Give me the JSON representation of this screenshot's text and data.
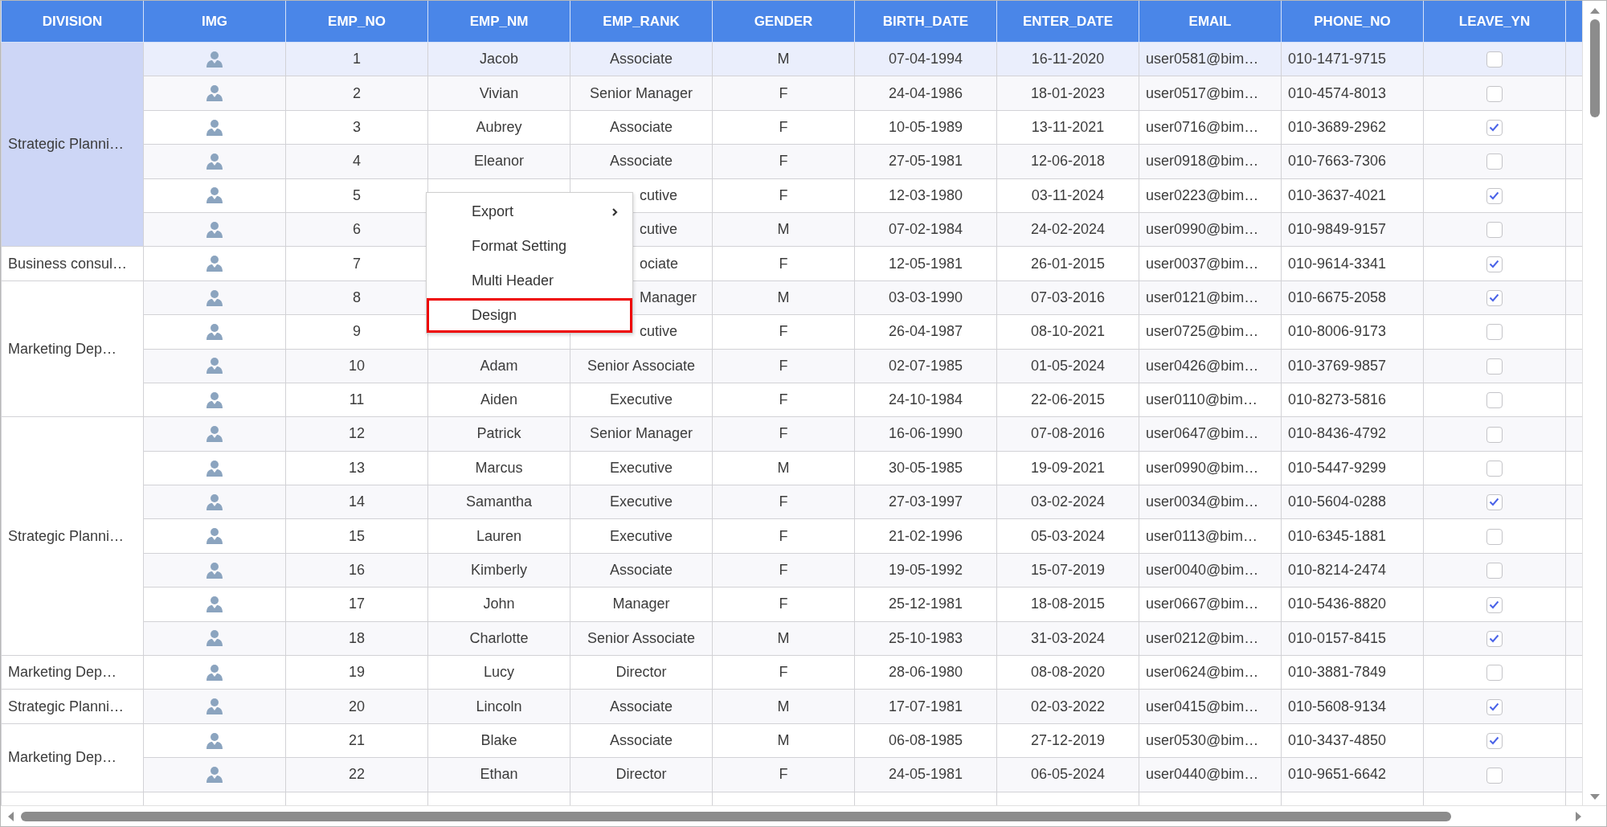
{
  "table": {
    "columns": [
      "DIVISION",
      "IMG",
      "EMP_NO",
      "EMP_NM",
      "EMP_RANK",
      "GENDER",
      "BIRTH_DATE",
      "ENTER_DATE",
      "EMAIL",
      "PHONE_NO",
      "LEAVE_YN"
    ],
    "divisions": [
      {
        "label": "Strategic Planni…",
        "selected": true,
        "rows": [
          {
            "no": "1",
            "name": "Jacob",
            "rank": "Associate",
            "gender": "M",
            "birth": "07-04-1994",
            "enter": "16-11-2020",
            "email": "user0581@bim…",
            "phone": "010-1471-9715",
            "leave_yn": false,
            "selected": true
          },
          {
            "no": "2",
            "name": "Vivian",
            "rank": "Senior Manager",
            "gender": "F",
            "birth": "24-04-1986",
            "enter": "18-01-2023",
            "email": "user0517@bim…",
            "phone": "010-4574-8013",
            "leave_yn": false,
            "selected": false
          },
          {
            "no": "3",
            "name": "Aubrey",
            "rank": "Associate",
            "gender": "F",
            "birth": "10-05-1989",
            "enter": "13-11-2021",
            "email": "user0716@bim…",
            "phone": "010-3689-2962",
            "leave_yn": true,
            "selected": false
          },
          {
            "no": "4",
            "name": "Eleanor",
            "rank": "Associate",
            "gender": "F",
            "birth": "27-05-1981",
            "enter": "12-06-2018",
            "email": "user0918@bim…",
            "phone": "010-7663-7306",
            "leave_yn": false,
            "selected": false
          },
          {
            "no": "5",
            "rank": "cutive",
            "covered": true,
            "gender": "F",
            "birth": "12-03-1980",
            "enter": "03-11-2024",
            "email": "user0223@bim…",
            "phone": "010-3637-4021",
            "leave_yn": true,
            "selected": false
          },
          {
            "no": "6",
            "rank": "cutive",
            "covered": true,
            "gender": "M",
            "birth": "07-02-1984",
            "enter": "24-02-2024",
            "email": "user0990@bim…",
            "phone": "010-9849-9157",
            "leave_yn": false,
            "selected": false
          }
        ]
      },
      {
        "label": "Business consul…",
        "selected": false,
        "rows": [
          {
            "no": "7",
            "rank": "ociate",
            "covered": true,
            "gender": "F",
            "birth": "12-05-1981",
            "enter": "26-01-2015",
            "email": "user0037@bim…",
            "phone": "010-9614-3341",
            "leave_yn": true,
            "selected": false
          }
        ]
      },
      {
        "label": "Marketing Dep…",
        "selected": false,
        "rows": [
          {
            "no": "8",
            "rank": "Manager",
            "covered": true,
            "gender": "M",
            "birth": "03-03-1990",
            "enter": "07-03-2016",
            "email": "user0121@bim…",
            "phone": "010-6675-2058",
            "leave_yn": true,
            "selected": false
          },
          {
            "no": "9",
            "rank": "cutive",
            "covered": true,
            "gender": "F",
            "birth": "26-04-1987",
            "enter": "08-10-2021",
            "email": "user0725@bim…",
            "phone": "010-8006-9173",
            "leave_yn": false,
            "selected": false
          },
          {
            "no": "10",
            "name": "Adam",
            "rank": "Senior Associate",
            "gender": "F",
            "birth": "02-07-1985",
            "enter": "01-05-2024",
            "email": "user0426@bim…",
            "phone": "010-3769-9857",
            "leave_yn": false,
            "selected": false
          },
          {
            "no": "11",
            "name": "Aiden",
            "rank": "Executive",
            "gender": "F",
            "birth": "24-10-1984",
            "enter": "22-06-2015",
            "email": "user0110@bim…",
            "phone": "010-8273-5816",
            "leave_yn": false,
            "selected": false
          }
        ]
      },
      {
        "label": "Strategic Planni…",
        "selected": false,
        "rows": [
          {
            "no": "12",
            "name": "Patrick",
            "rank": "Senior Manager",
            "gender": "F",
            "birth": "16-06-1990",
            "enter": "07-08-2016",
            "email": "user0647@bim…",
            "phone": "010-8436-4792",
            "leave_yn": false,
            "selected": false
          },
          {
            "no": "13",
            "name": "Marcus",
            "rank": "Executive",
            "gender": "M",
            "birth": "30-05-1985",
            "enter": "19-09-2021",
            "email": "user0990@bim…",
            "phone": "010-5447-9299",
            "leave_yn": false,
            "selected": false
          },
          {
            "no": "14",
            "name": "Samantha",
            "rank": "Executive",
            "gender": "F",
            "birth": "27-03-1997",
            "enter": "03-02-2024",
            "email": "user0034@bim…",
            "phone": "010-5604-0288",
            "leave_yn": true,
            "selected": false
          },
          {
            "no": "15",
            "name": "Lauren",
            "rank": "Executive",
            "gender": "F",
            "birth": "21-02-1996",
            "enter": "05-03-2024",
            "email": "user0113@bim…",
            "phone": "010-6345-1881",
            "leave_yn": false,
            "selected": false
          },
          {
            "no": "16",
            "name": "Kimberly",
            "rank": "Associate",
            "gender": "F",
            "birth": "19-05-1992",
            "enter": "15-07-2019",
            "email": "user0040@bim…",
            "phone": "010-8214-2474",
            "leave_yn": false,
            "selected": false
          },
          {
            "no": "17",
            "name": "John",
            "rank": "Manager",
            "gender": "F",
            "birth": "25-12-1981",
            "enter": "18-08-2015",
            "email": "user0667@bim…",
            "phone": "010-5436-8820",
            "leave_yn": true,
            "selected": false
          },
          {
            "no": "18",
            "name": "Charlotte",
            "rank": "Senior Associate",
            "gender": "M",
            "birth": "25-10-1983",
            "enter": "31-03-2024",
            "email": "user0212@bim…",
            "phone": "010-0157-8415",
            "leave_yn": true,
            "selected": false
          }
        ]
      },
      {
        "label": "Marketing Dep…",
        "selected": false,
        "rows": [
          {
            "no": "19",
            "name": "Lucy",
            "rank": "Director",
            "gender": "F",
            "birth": "28-06-1980",
            "enter": "08-08-2020",
            "email": "user0624@bim…",
            "phone": "010-3881-7849",
            "leave_yn": false,
            "selected": false
          }
        ]
      },
      {
        "label": "Strategic Planni…",
        "selected": false,
        "rows": [
          {
            "no": "20",
            "name": "Lincoln",
            "rank": "Associate",
            "gender": "M",
            "birth": "17-07-1981",
            "enter": "02-03-2022",
            "email": "user0415@bim…",
            "phone": "010-5608-9134",
            "leave_yn": true,
            "selected": false
          }
        ]
      },
      {
        "label": "Marketing Dep…",
        "selected": false,
        "rows": [
          {
            "no": "21",
            "name": "Blake",
            "rank": "Associate",
            "gender": "M",
            "birth": "06-08-1985",
            "enter": "27-12-2019",
            "email": "user0530@bim…",
            "phone": "010-3437-4850",
            "leave_yn": true,
            "selected": false
          },
          {
            "no": "22",
            "name": "Ethan",
            "rank": "Director",
            "gender": "F",
            "birth": "24-05-1981",
            "enter": "06-05-2024",
            "email": "user0440@bim…",
            "phone": "010-9651-6642",
            "leave_yn": false,
            "selected": false
          }
        ]
      }
    ]
  },
  "context_menu": {
    "items": [
      {
        "label": "Export",
        "submenu": true,
        "selected": false
      },
      {
        "label": "Format Setting",
        "submenu": false,
        "selected": false
      },
      {
        "label": "Multi Header",
        "submenu": false,
        "selected": false
      },
      {
        "label": "Design",
        "submenu": false,
        "selected": true
      }
    ]
  }
}
